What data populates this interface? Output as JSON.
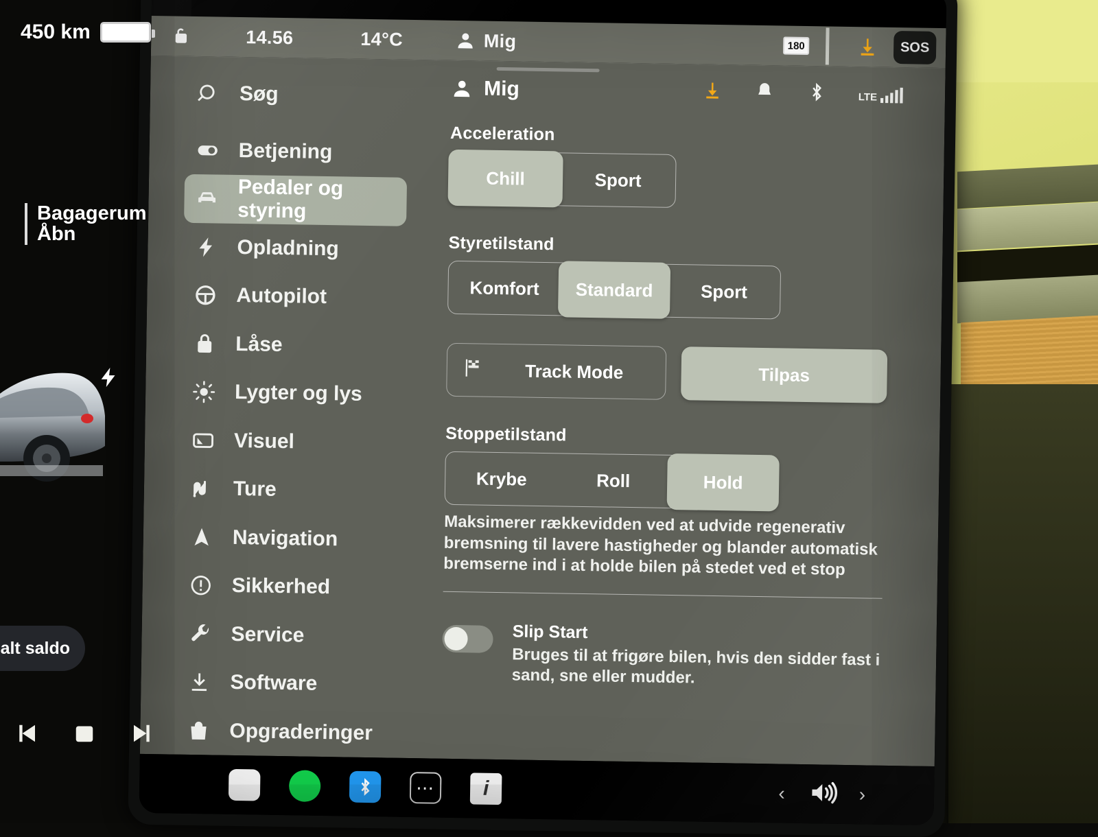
{
  "statusbar": {
    "lock_icon": "unlocked-padlock-icon",
    "time": "14.56",
    "temperature": "14°C",
    "profile_icon": "person-icon",
    "profile_name": "Mig",
    "speed_limit": "180",
    "download_icon": "download-icon",
    "sos_label": "SOS"
  },
  "settings": {
    "header": {
      "title": "Mig",
      "user_icon": "person-icon",
      "icons": [
        "download-icon",
        "bell-icon",
        "bluetooth-icon",
        "lte-signal-icon"
      ],
      "lte_label": "LTE"
    },
    "search_label": "Søg",
    "sidebar": [
      {
        "label": "Betjening",
        "icon": "toggle-switch-icon",
        "active": false
      },
      {
        "label": "Pedaler og styring",
        "icon": "car-front-icon",
        "active": true
      },
      {
        "label": "Opladning",
        "icon": "lightning-bolt-icon",
        "active": false
      },
      {
        "label": "Autopilot",
        "icon": "steering-wheel-icon",
        "active": false
      },
      {
        "label": "Låse",
        "icon": "lock-icon",
        "active": false
      },
      {
        "label": "Lygter og lys",
        "icon": "headlight-icon",
        "active": false
      },
      {
        "label": "Visuel",
        "icon": "display-icon",
        "active": false
      },
      {
        "label": "Ture",
        "icon": "road-winding-icon",
        "active": false
      },
      {
        "label": "Navigation",
        "icon": "navigation-arrow-icon",
        "active": false
      },
      {
        "label": "Sikkerhed",
        "icon": "exclamation-circle-icon",
        "active": false
      },
      {
        "label": "Service",
        "icon": "wrench-icon",
        "active": false
      },
      {
        "label": "Software",
        "icon": "download-icon",
        "active": false
      },
      {
        "label": "Opgraderinger",
        "icon": "shopping-bag-icon",
        "active": false
      }
    ],
    "sections": {
      "acceleration": {
        "title": "Acceleration",
        "options": [
          "Chill",
          "Sport"
        ],
        "selected": "Chill"
      },
      "steering": {
        "title": "Styretilstand",
        "options": [
          "Komfort",
          "Standard",
          "Sport"
        ],
        "selected": "Standard"
      },
      "track_row": {
        "track_mode_label": "Track Mode",
        "track_mode_icon": "checkered-flag-icon",
        "customize_label": "Tilpas"
      },
      "stopping": {
        "title": "Stoppetilstand",
        "options": [
          "Krybe",
          "Roll",
          "Hold"
        ],
        "selected": "Hold",
        "description": "Maksimerer rækkevidden ved at udvide regenerativ bremsning til lavere hastigheder og blander automatisk bremserne ind i at holde bilen på stedet ved et stop"
      },
      "slip_start": {
        "title": "Slip Start",
        "description": "Bruges til at frigøre bilen, hvis den sidder fast i sand, sne eller mudder.",
        "enabled": false
      }
    }
  },
  "car_pane": {
    "range": "450 km",
    "battery_icon": "battery-icon",
    "tooltip_title": "Bagagerum",
    "tooltip_action": "Åbn",
    "saldo_pill": "alt saldo",
    "charge_port_icon": "lightning-bolt-icon",
    "media": {
      "previous_icon": "skip-previous-icon",
      "stop_icon": "stop-icon",
      "next_icon": "skip-next-icon"
    }
  },
  "dock": {
    "apps": [
      {
        "icon": "card-app-icon"
      },
      {
        "icon": "spotify-app-icon"
      },
      {
        "icon": "bluetooth-app-icon"
      },
      {
        "icon": "more-apps-icon"
      },
      {
        "icon": "info-app-icon"
      }
    ],
    "volume_prev_icon": "chevron-left-icon",
    "volume_icon": "speaker-volume-icon",
    "volume_next_icon": "chevron-right-icon"
  },
  "colors": {
    "panel_bg": "#5f6159",
    "selected_btn": "#bcc2b4",
    "statusbar_bg": "#6d6f66",
    "accent_amber": "#f2a818"
  }
}
